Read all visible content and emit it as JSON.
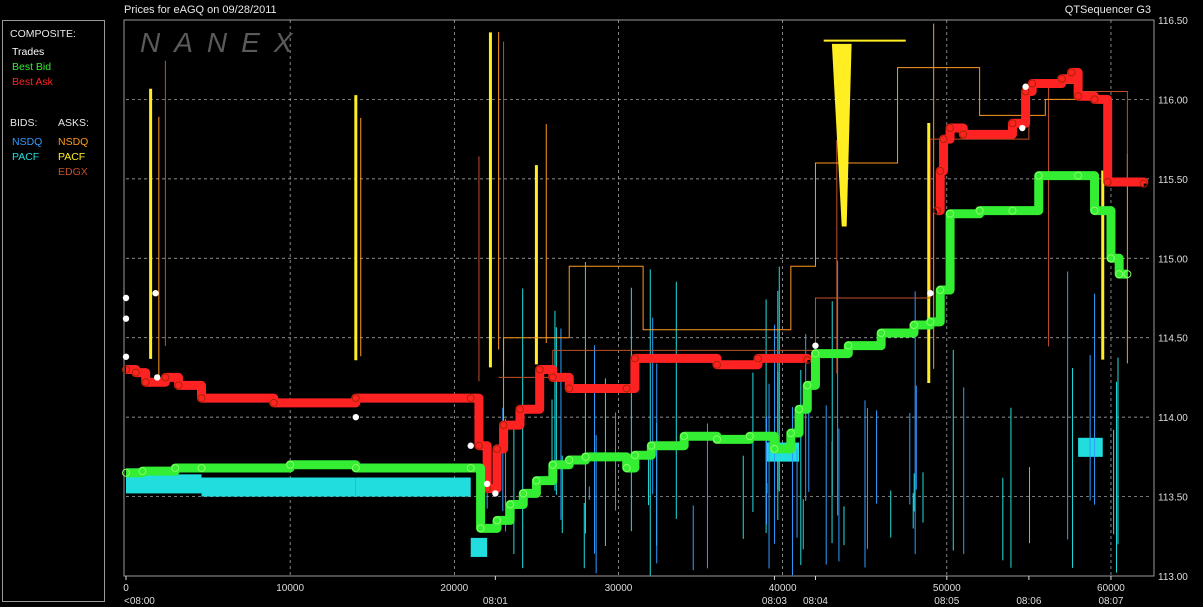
{
  "header": {
    "title": "Prices for  eAGQ  on  09/28/2011",
    "app_name": "QTSequencer G3"
  },
  "legend": {
    "composite_label": "COMPOSITE:",
    "composite_items": [
      {
        "label": "Trades",
        "color": "#ffffff"
      },
      {
        "label": "Best Bid",
        "color": "#33ee33"
      },
      {
        "label": "Best Ask",
        "color": "#ff2222"
      }
    ],
    "bids_label": "BIDS:",
    "asks_label": "ASKS:",
    "bids": [
      {
        "label": "NSDQ",
        "color": "#2f9cff"
      },
      {
        "label": "PACF",
        "color": "#22dddd"
      }
    ],
    "asks": [
      {
        "label": "NSDQ",
        "color": "#ff9922"
      },
      {
        "label": "PACF",
        "color": "#ffee22"
      },
      {
        "label": "EDGX",
        "color": "#c0502a"
      }
    ]
  },
  "watermark": "NANEX",
  "chart_data": {
    "type": "line",
    "title": "Prices for  eAGQ  on  09/28/2011",
    "xlim": [
      0,
      62500
    ],
    "ylim": [
      113.0,
      116.5
    ],
    "grid": true,
    "x_ticks": [
      0,
      10000,
      20000,
      30000,
      40000,
      50000,
      60000
    ],
    "y_ticks": [
      "113.00",
      "113.50",
      "114.00",
      "114.50",
      "115.00",
      "115.50",
      "116.00",
      "116.50"
    ],
    "time_labels": [
      {
        "x": 0,
        "label": "<08:00"
      },
      {
        "x": 22500,
        "label": "08:01"
      },
      {
        "x": 39500,
        "label": "08:03"
      },
      {
        "x": 42000,
        "label": "08:04"
      },
      {
        "x": 50000,
        "label": "08:05"
      },
      {
        "x": 55000,
        "label": "08:06"
      },
      {
        "x": 60000,
        "label": "08:07"
      }
    ],
    "series": [
      {
        "name": "Best Ask",
        "color": "#ff2222",
        "x": [
          0,
          600,
          1200,
          2400,
          3200,
          4600,
          9000,
          14000,
          21000,
          21500,
          22000,
          22600,
          23000,
          24000,
          25200,
          26000,
          27000,
          30500,
          31000,
          36000,
          38500,
          41500
        ],
        "y": [
          114.3,
          114.28,
          114.22,
          114.25,
          114.2,
          114.12,
          114.09,
          114.12,
          114.12,
          113.82,
          113.55,
          113.8,
          113.95,
          114.05,
          114.3,
          114.25,
          114.18,
          114.18,
          114.37,
          114.33,
          114.37,
          114.36
        ]
      },
      {
        "name": "Best Ask",
        "color": "#ff2222",
        "x": [
          49400,
          49600,
          49800,
          50200,
          51000,
          54000,
          54800,
          55200,
          57000,
          57600,
          58000,
          59000,
          59800,
          62000
        ],
        "y": [
          115.3,
          115.55,
          115.75,
          115.82,
          115.78,
          115.85,
          116.05,
          116.1,
          116.13,
          116.17,
          116.02,
          116.0,
          115.48,
          115.47
        ]
      },
      {
        "name": "Best Bid",
        "color": "#33ee33",
        "x": [
          0,
          1000,
          3000,
          4600,
          10000,
          14000,
          21000,
          21600,
          22600,
          23400,
          24200,
          25000,
          26000,
          27000,
          28000,
          30500,
          31000,
          32000,
          34000,
          36000,
          38000,
          39500,
          40500,
          41000,
          41500,
          42000,
          44000,
          46000,
          48000,
          49000,
          49600,
          50200,
          52000,
          54000,
          55600,
          58000,
          59000,
          60000,
          60500,
          61000
        ],
        "y": [
          113.65,
          113.66,
          113.68,
          113.68,
          113.7,
          113.68,
          113.68,
          113.3,
          113.35,
          113.45,
          113.52,
          113.6,
          113.7,
          113.73,
          113.75,
          113.68,
          113.76,
          113.82,
          113.88,
          113.86,
          113.88,
          113.8,
          113.9,
          114.05,
          114.2,
          114.4,
          114.45,
          114.53,
          114.58,
          114.6,
          114.8,
          115.28,
          115.3,
          115.3,
          115.52,
          115.52,
          115.3,
          115.0,
          114.9,
          114.9
        ]
      }
    ],
    "annotations": [
      "<08:00",
      "08:01",
      "08:03",
      "08:04",
      "08:05",
      "08:06",
      "08:07"
    ]
  }
}
